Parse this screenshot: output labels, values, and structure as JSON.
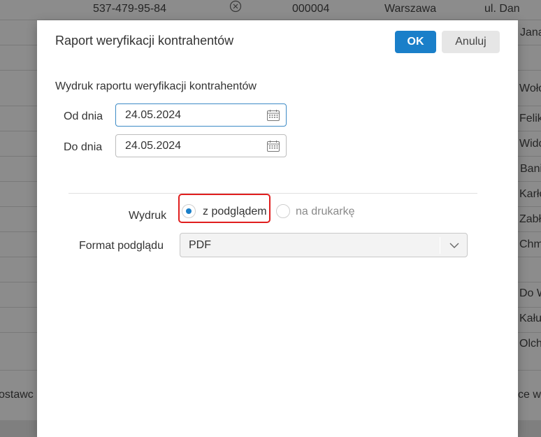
{
  "background": {
    "row0": {
      "phone": "537-479-95-84",
      "id": "000004",
      "city": "Warszawa",
      "street": "ul. Dan"
    },
    "right_cells": [
      "Jana",
      "Woło",
      "Felik",
      "Wido",
      "Bani",
      "Karło",
      "Zabł",
      "Chm",
      "Do W",
      "Kału",
      "Olch",
      "ce wy"
    ],
    "left_cell": "ostawc"
  },
  "dialog": {
    "title": "Raport weryfikacji kontrahentów",
    "ok_label": "OK",
    "cancel_label": "Anuluj",
    "section_title": "Wydruk raportu weryfikacji kontrahentów",
    "from_label": "Od dnia",
    "from_value": "24.05.2024",
    "to_label": "Do dnia",
    "to_value": "24.05.2024",
    "print_label": "Wydruk",
    "print_options": [
      {
        "label": "z podglądem",
        "checked": true
      },
      {
        "label": "na drukarkę",
        "checked": false
      }
    ],
    "format_label": "Format podglądu",
    "format_value": "PDF"
  },
  "colors": {
    "accent": "#1a7fc9",
    "highlight": "#e01e1e"
  }
}
